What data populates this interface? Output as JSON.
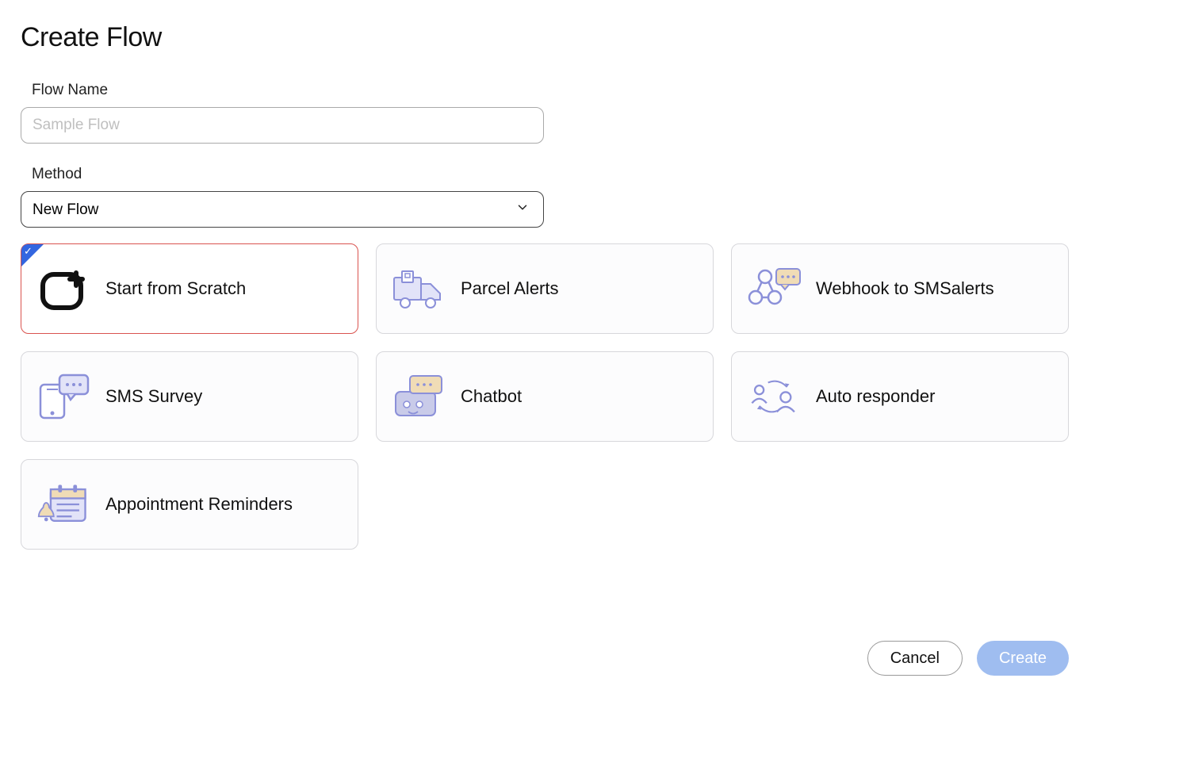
{
  "page": {
    "title": "Create Flow"
  },
  "form": {
    "flow_name_label": "Flow Name",
    "flow_name_placeholder": "Sample Flow",
    "flow_name_value": "",
    "method_label": "Method",
    "method_selected": "New Flow"
  },
  "templates": [
    {
      "id": "start-from-scratch",
      "label": "Start from Scratch",
      "selected": true
    },
    {
      "id": "parcel-alerts",
      "label": "Parcel Alerts",
      "selected": false
    },
    {
      "id": "webhook-to-smsalerts",
      "label": "Webhook to SMSalerts",
      "selected": false
    },
    {
      "id": "sms-survey",
      "label": "SMS Survey",
      "selected": false
    },
    {
      "id": "chatbot",
      "label": "Chatbot",
      "selected": false
    },
    {
      "id": "auto-responder",
      "label": "Auto responder",
      "selected": false
    },
    {
      "id": "appointment-reminders",
      "label": "Appointment Reminders",
      "selected": false
    }
  ],
  "actions": {
    "cancel_label": "Cancel",
    "create_label": "Create"
  }
}
